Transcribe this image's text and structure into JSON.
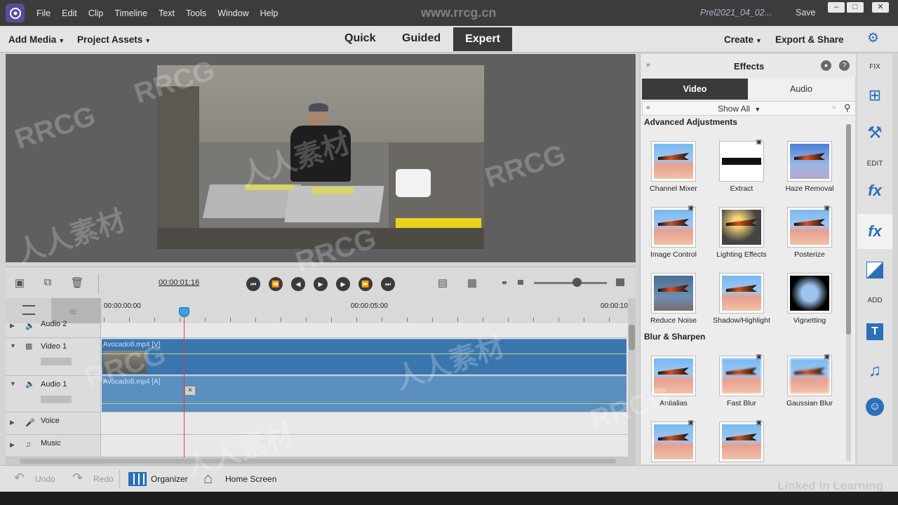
{
  "menu": {
    "items": [
      "File",
      "Edit",
      "Clip",
      "Timeline",
      "Text",
      "Tools",
      "Window",
      "Help"
    ]
  },
  "titlebar": {
    "project_name": "Prel2021_04_02...",
    "save": "Save",
    "watermark": "www.rrcg.cn"
  },
  "modebar": {
    "add_media": "Add Media",
    "project_assets": "Project Assets",
    "tabs": [
      "Quick",
      "Guided",
      "Expert"
    ],
    "create": "Create",
    "export": "Export & Share"
  },
  "timeline": {
    "timecode": "00:00:01:16",
    "ruler": [
      "00:00:00:00",
      "00:00:05:00",
      "00:00:10"
    ],
    "tracks": [
      {
        "name": "Audio 2"
      },
      {
        "name": "Video 1",
        "clip": "Avocado8.mp4 [V]"
      },
      {
        "name": "Audio 1",
        "clip": "Avocado8.mp4 [A]"
      },
      {
        "name": "Voice"
      },
      {
        "name": "Music"
      }
    ]
  },
  "effects": {
    "title": "Effects",
    "tabs": [
      "Video",
      "Audio"
    ],
    "filter": "Show All",
    "sections": [
      {
        "title": "Advanced Adjustments",
        "items": [
          "Channel Mixer",
          "Extract",
          "Haze Removal",
          "Image Control",
          "Lighting Effects",
          "Posterize",
          "Reduce Noise",
          "Shadow/Highlight",
          "Vignetting"
        ]
      },
      {
        "title": "Blur & Sharpen",
        "items": [
          "Antialias",
          "Fast Blur",
          "Gaussian Blur",
          "",
          ""
        ]
      }
    ]
  },
  "rightstrip": {
    "fix": "FIX",
    "edit": "EDIT",
    "add": "ADD"
  },
  "bottombar": {
    "undo": "Undo",
    "redo": "Redo",
    "organizer": "Organizer",
    "home": "Home Screen"
  },
  "branding": {
    "linkedin": "Linked in Learning",
    "watermark_text": "RRCG",
    "watermark_cn": "人人素材"
  },
  "colors": {
    "accent": "#2a6fb8",
    "clip": "#3a76ad",
    "playhead": "#e23a3a"
  }
}
